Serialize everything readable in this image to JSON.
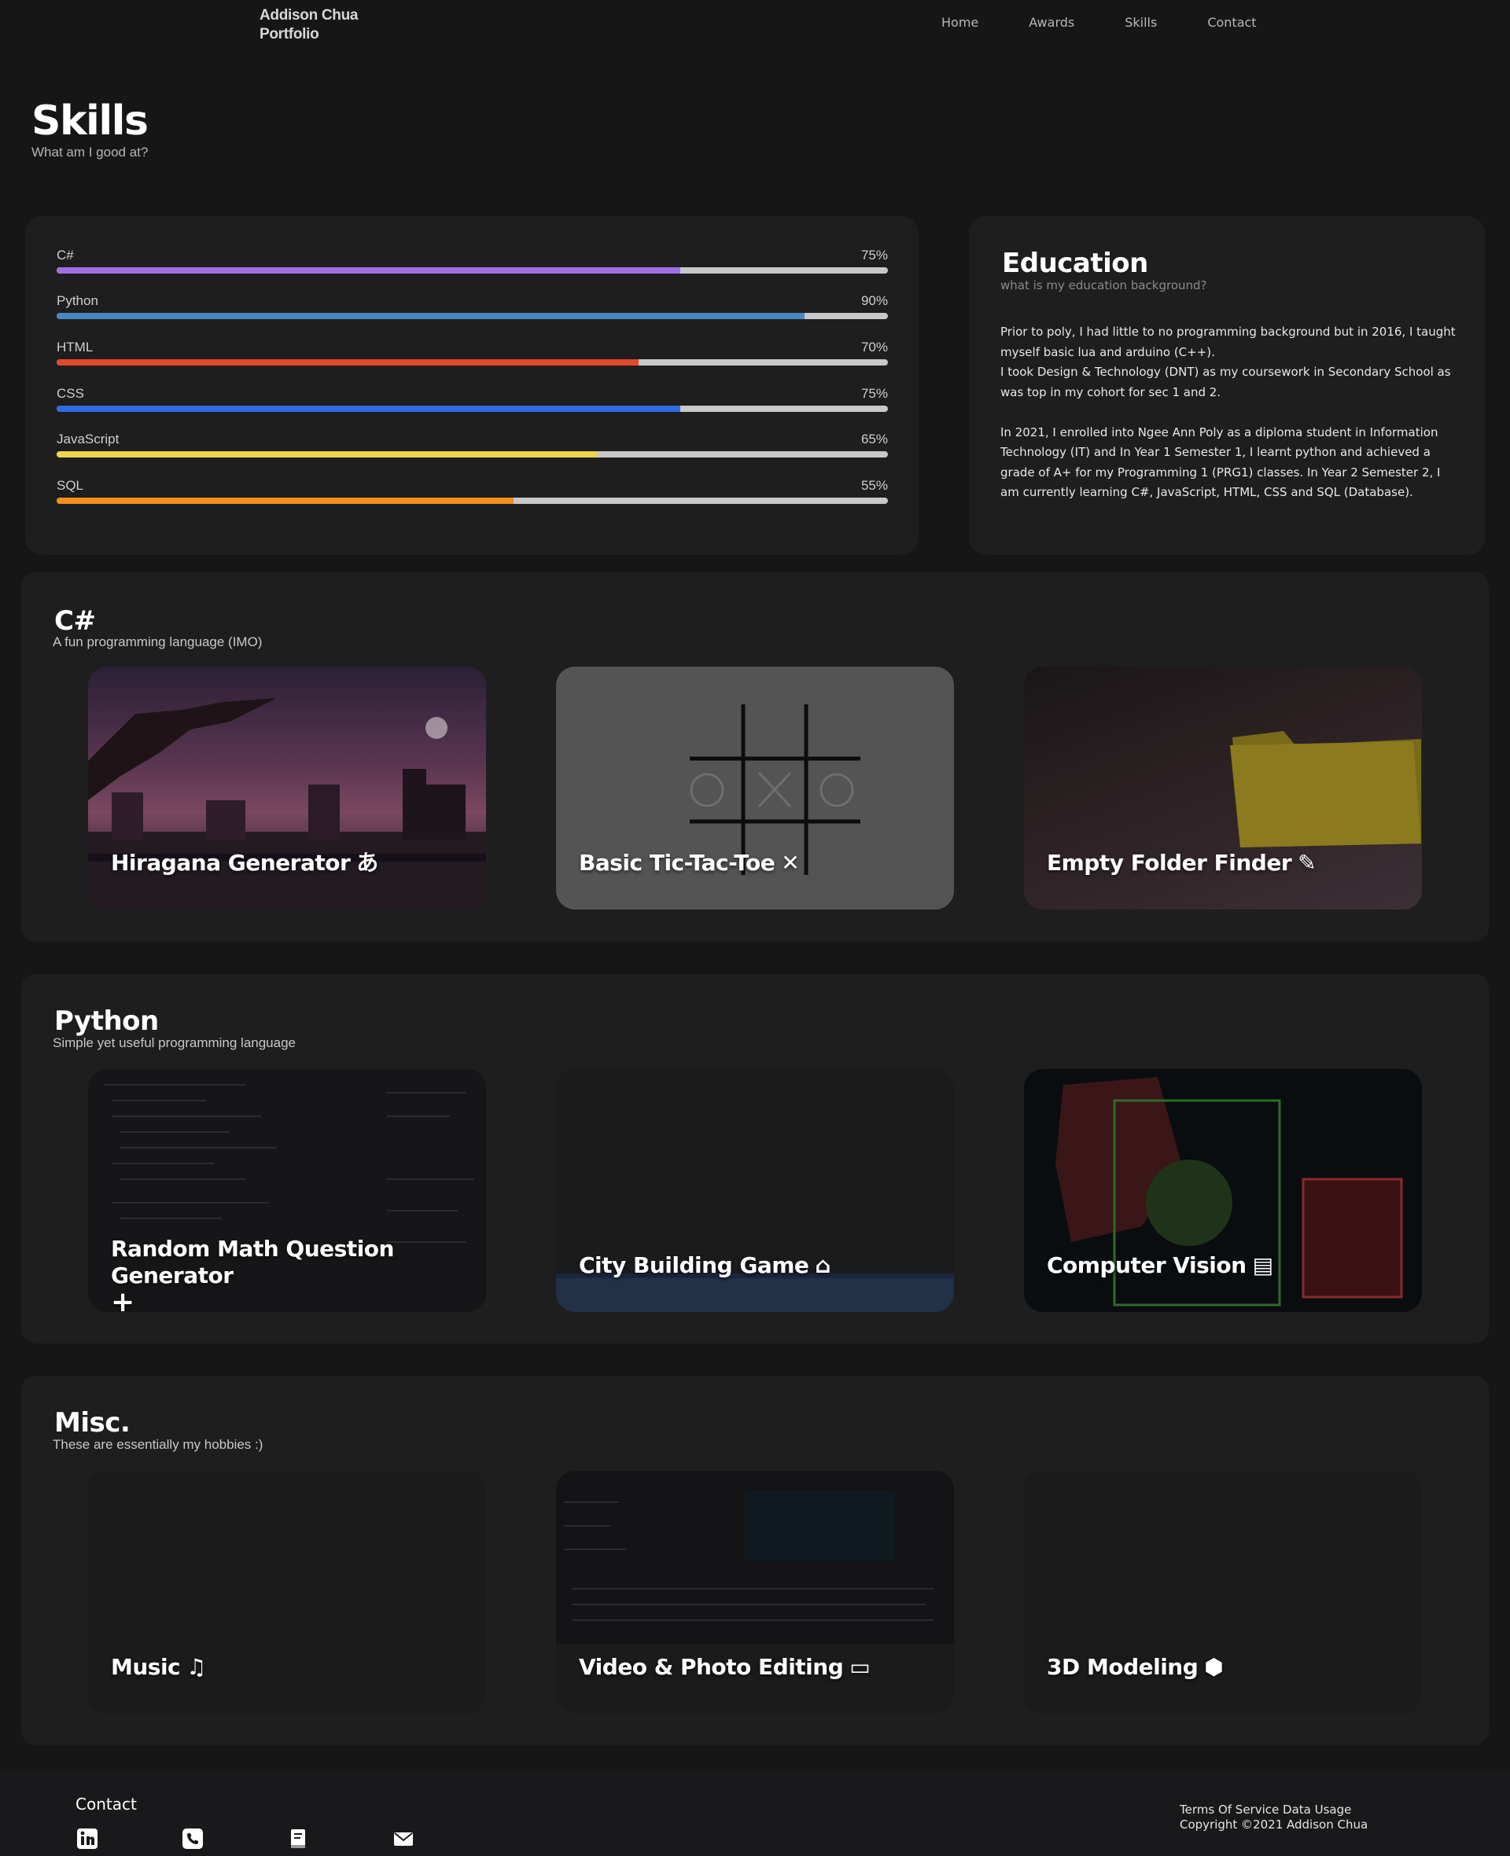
{
  "nav": {
    "brand_line1": "Addison Chua",
    "brand_line2": "Portfolio",
    "links": [
      "Home",
      "Awards",
      "Skills",
      "Contact"
    ]
  },
  "hero": {
    "title": "Skills",
    "subtitle": "What am I good at?"
  },
  "skills": [
    {
      "name": "C#",
      "percent_label": "75%",
      "value": 75,
      "color": "#a06fe8"
    },
    {
      "name": "Python",
      "percent_label": "90%",
      "value": 90,
      "color": "#4a87c4"
    },
    {
      "name": "HTML",
      "percent_label": "70%",
      "value": 70,
      "color": "#e04a2a"
    },
    {
      "name": "CSS",
      "percent_label": "75%",
      "value": 75,
      "color": "#2e6be6"
    },
    {
      "name": "JavaScript",
      "percent_label": "65%",
      "value": 65,
      "color": "#f0d64a"
    },
    {
      "name": "SQL",
      "percent_label": "55%",
      "value": 55,
      "color": "#f28e1c"
    }
  ],
  "education": {
    "title": "Education",
    "subtitle": "what is my education background?",
    "para1_line1": "Prior to poly, I had little to no programming background but in 2016, I taught myself basic lua and arduino (C++).",
    "para1_line2": "I took Design & Technology (DNT) as my coursework in Secondary School as was top in my cohort for sec 1 and 2.",
    "para2": "In 2021, I enrolled into Ngee Ann Poly as a diploma student in Information Technology (IT) and In Year 1 Semester 1, I learnt python and achieved a grade of A+ for my Programming 1 (PRG1) classes. In Year 2 Semester 2, I am currently learning C#, JavaScript, HTML, CSS and SQL (Database)."
  },
  "sections": [
    {
      "title": "C#",
      "subtitle": "A fun programming language (IMO)",
      "cards": [
        {
          "label": "Hiragana Generator",
          "icon": "あ",
          "icon_name": "hiragana-icon"
        },
        {
          "label": "Basic Tic-Tac-Toe",
          "icon": "✕",
          "icon_name": "x-mark-icon"
        },
        {
          "label": "Empty Folder Finder",
          "icon": "✎",
          "icon_name": "pen-icon"
        }
      ]
    },
    {
      "title": "Python",
      "subtitle": "Simple yet useful programming language",
      "cards": [
        {
          "label": "Random Math Question Generator",
          "icon": "+",
          "icon_name": "plus-icon"
        },
        {
          "label": "City Building Game",
          "icon": "⌂",
          "icon_name": "house-icon"
        },
        {
          "label": "Computer Vision",
          "icon": "▤",
          "icon_name": "document-icon"
        }
      ]
    },
    {
      "title": "Misc.",
      "subtitle": "These are essentially my hobbies :)",
      "cards": [
        {
          "label": "Music",
          "icon": "♫",
          "icon_name": "music-note-icon"
        },
        {
          "label": "Video & Photo Editing",
          "icon": "▭",
          "icon_name": "film-icon"
        },
        {
          "label": "3D Modeling",
          "icon": "⬢",
          "icon_name": "cube-icon"
        }
      ]
    }
  ],
  "footer": {
    "contact_title": "Contact",
    "icons": [
      "linkedin-icon",
      "phone-icon",
      "resume-icon",
      "mail-icon"
    ],
    "terms": "Terms Of Service",
    "data_usage": "Data Usage",
    "copyright": "Copyright ©2021 Addison Chua"
  }
}
